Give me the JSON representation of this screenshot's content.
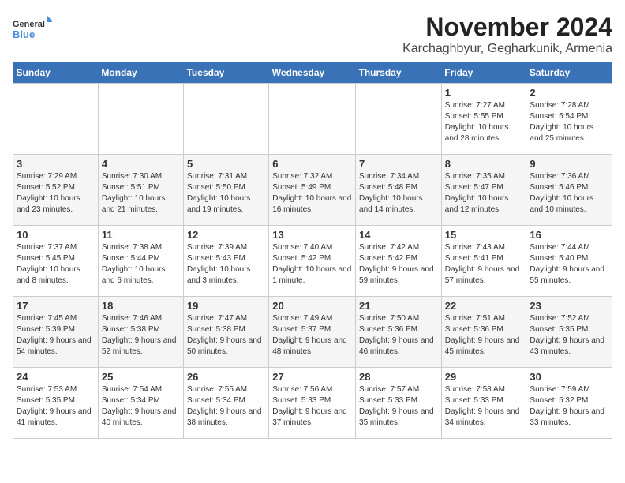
{
  "logo": {
    "text_general": "General",
    "text_blue": "Blue"
  },
  "header": {
    "month": "November 2024",
    "location": "Karchaghbyur, Gegharkunik, Armenia"
  },
  "weekdays": [
    "Sunday",
    "Monday",
    "Tuesday",
    "Wednesday",
    "Thursday",
    "Friday",
    "Saturday"
  ],
  "weeks": [
    [
      {
        "day": "",
        "info": ""
      },
      {
        "day": "",
        "info": ""
      },
      {
        "day": "",
        "info": ""
      },
      {
        "day": "",
        "info": ""
      },
      {
        "day": "",
        "info": ""
      },
      {
        "day": "1",
        "info": "Sunrise: 7:27 AM\nSunset: 5:55 PM\nDaylight: 10 hours and 28 minutes."
      },
      {
        "day": "2",
        "info": "Sunrise: 7:28 AM\nSunset: 5:54 PM\nDaylight: 10 hours and 25 minutes."
      }
    ],
    [
      {
        "day": "3",
        "info": "Sunrise: 7:29 AM\nSunset: 5:52 PM\nDaylight: 10 hours and 23 minutes."
      },
      {
        "day": "4",
        "info": "Sunrise: 7:30 AM\nSunset: 5:51 PM\nDaylight: 10 hours and 21 minutes."
      },
      {
        "day": "5",
        "info": "Sunrise: 7:31 AM\nSunset: 5:50 PM\nDaylight: 10 hours and 19 minutes."
      },
      {
        "day": "6",
        "info": "Sunrise: 7:32 AM\nSunset: 5:49 PM\nDaylight: 10 hours and 16 minutes."
      },
      {
        "day": "7",
        "info": "Sunrise: 7:34 AM\nSunset: 5:48 PM\nDaylight: 10 hours and 14 minutes."
      },
      {
        "day": "8",
        "info": "Sunrise: 7:35 AM\nSunset: 5:47 PM\nDaylight: 10 hours and 12 minutes."
      },
      {
        "day": "9",
        "info": "Sunrise: 7:36 AM\nSunset: 5:46 PM\nDaylight: 10 hours and 10 minutes."
      }
    ],
    [
      {
        "day": "10",
        "info": "Sunrise: 7:37 AM\nSunset: 5:45 PM\nDaylight: 10 hours and 8 minutes."
      },
      {
        "day": "11",
        "info": "Sunrise: 7:38 AM\nSunset: 5:44 PM\nDaylight: 10 hours and 6 minutes."
      },
      {
        "day": "12",
        "info": "Sunrise: 7:39 AM\nSunset: 5:43 PM\nDaylight: 10 hours and 3 minutes."
      },
      {
        "day": "13",
        "info": "Sunrise: 7:40 AM\nSunset: 5:42 PM\nDaylight: 10 hours and 1 minute."
      },
      {
        "day": "14",
        "info": "Sunrise: 7:42 AM\nSunset: 5:42 PM\nDaylight: 9 hours and 59 minutes."
      },
      {
        "day": "15",
        "info": "Sunrise: 7:43 AM\nSunset: 5:41 PM\nDaylight: 9 hours and 57 minutes."
      },
      {
        "day": "16",
        "info": "Sunrise: 7:44 AM\nSunset: 5:40 PM\nDaylight: 9 hours and 55 minutes."
      }
    ],
    [
      {
        "day": "17",
        "info": "Sunrise: 7:45 AM\nSunset: 5:39 PM\nDaylight: 9 hours and 54 minutes."
      },
      {
        "day": "18",
        "info": "Sunrise: 7:46 AM\nSunset: 5:38 PM\nDaylight: 9 hours and 52 minutes."
      },
      {
        "day": "19",
        "info": "Sunrise: 7:47 AM\nSunset: 5:38 PM\nDaylight: 9 hours and 50 minutes."
      },
      {
        "day": "20",
        "info": "Sunrise: 7:49 AM\nSunset: 5:37 PM\nDaylight: 9 hours and 48 minutes."
      },
      {
        "day": "21",
        "info": "Sunrise: 7:50 AM\nSunset: 5:36 PM\nDaylight: 9 hours and 46 minutes."
      },
      {
        "day": "22",
        "info": "Sunrise: 7:51 AM\nSunset: 5:36 PM\nDaylight: 9 hours and 45 minutes."
      },
      {
        "day": "23",
        "info": "Sunrise: 7:52 AM\nSunset: 5:35 PM\nDaylight: 9 hours and 43 minutes."
      }
    ],
    [
      {
        "day": "24",
        "info": "Sunrise: 7:53 AM\nSunset: 5:35 PM\nDaylight: 9 hours and 41 minutes."
      },
      {
        "day": "25",
        "info": "Sunrise: 7:54 AM\nSunset: 5:34 PM\nDaylight: 9 hours and 40 minutes."
      },
      {
        "day": "26",
        "info": "Sunrise: 7:55 AM\nSunset: 5:34 PM\nDaylight: 9 hours and 38 minutes."
      },
      {
        "day": "27",
        "info": "Sunrise: 7:56 AM\nSunset: 5:33 PM\nDaylight: 9 hours and 37 minutes."
      },
      {
        "day": "28",
        "info": "Sunrise: 7:57 AM\nSunset: 5:33 PM\nDaylight: 9 hours and 35 minutes."
      },
      {
        "day": "29",
        "info": "Sunrise: 7:58 AM\nSunset: 5:33 PM\nDaylight: 9 hours and 34 minutes."
      },
      {
        "day": "30",
        "info": "Sunrise: 7:59 AM\nSunset: 5:32 PM\nDaylight: 9 hours and 33 minutes."
      }
    ]
  ]
}
